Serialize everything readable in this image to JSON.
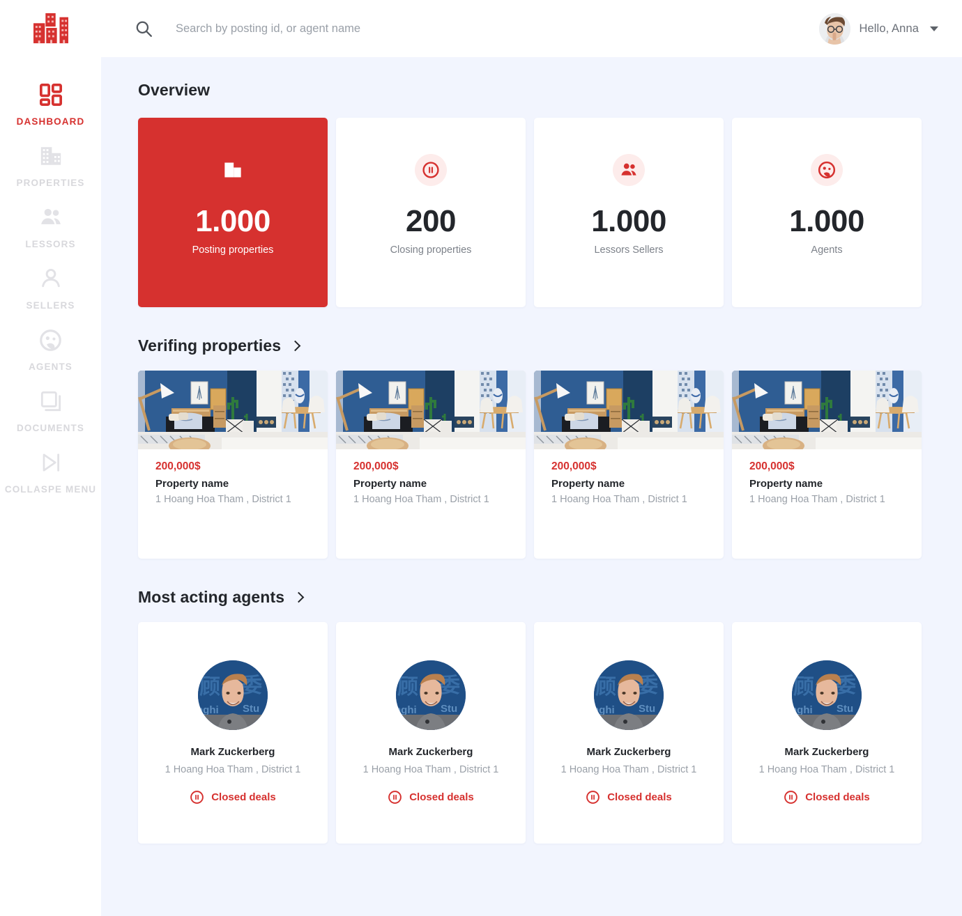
{
  "brand": {
    "logo_icon": "buildings-logo-icon",
    "accent_color": "#d6312f",
    "bg_color": "#f2f5fe"
  },
  "topbar": {
    "search": {
      "icon": "search-icon",
      "value": "",
      "placeholder": "Search by posting id, or agent name"
    },
    "user": {
      "greeting": "Hello, Anna",
      "avatar_icon": "user-avatar",
      "caret_icon": "chevron-down-icon"
    }
  },
  "sidebar": {
    "items": [
      {
        "label": "DASHBOARD",
        "icon": "dashboard-grid-icon",
        "active": true
      },
      {
        "label": "PROPERTIES",
        "icon": "building-icon",
        "active": false
      },
      {
        "label": "LESSORS",
        "icon": "people-group-icon",
        "active": false
      },
      {
        "label": "SELLERS",
        "icon": "person-icon",
        "active": false
      },
      {
        "label": "AGENTS",
        "icon": "support-agent-icon",
        "active": false
      },
      {
        "label": "DOCUMENTS",
        "icon": "documents-layers-icon",
        "active": false
      },
      {
        "label": "COLLASPE MENU",
        "icon": "collapse-skip-icon",
        "active": false
      }
    ]
  },
  "overview": {
    "title": "Overview",
    "cards": [
      {
        "value": "1.000",
        "label": "Posting properties",
        "icon": "building-icon",
        "accent": true
      },
      {
        "value": "200",
        "label": "Closing properties",
        "icon": "pause-circle-icon",
        "accent": false
      },
      {
        "value": "1.000",
        "label": "Lessors Sellers",
        "icon": "people-group-icon",
        "accent": false
      },
      {
        "value": "1.000",
        "label": "Agents",
        "icon": "support-agent-icon",
        "accent": false
      }
    ]
  },
  "verifying": {
    "title": "Verifing properties",
    "chevron_icon": "chevron-right-icon",
    "cards": [
      {
        "price": "200,000$",
        "name": "Property name",
        "address": "1 Hoang Hoa Tham , District 1",
        "image": "apartment-interior-photo"
      },
      {
        "price": "200,000$",
        "name": "Property name",
        "address": "1 Hoang Hoa Tham , District 1",
        "image": "apartment-interior-photo"
      },
      {
        "price": "200,000$",
        "name": "Property name",
        "address": "1 Hoang Hoa Tham , District 1",
        "image": "apartment-interior-photo"
      },
      {
        "price": "200,000$",
        "name": "Property name",
        "address": "1 Hoang Hoa Tham , District 1",
        "image": "apartment-interior-photo"
      }
    ]
  },
  "agents": {
    "title": "Most acting agents",
    "chevron_icon": "chevron-right-icon",
    "cards": [
      {
        "name": "Mark Zuckerberg",
        "address": "1 Hoang Hoa Tham , District 1",
        "deals_label": "Closed deals",
        "deals_icon": "pause-circle-icon",
        "avatar": "agent-portrait-photo"
      },
      {
        "name": "Mark Zuckerberg",
        "address": "1 Hoang Hoa Tham , District 1",
        "deals_label": "Closed deals",
        "deals_icon": "pause-circle-icon",
        "avatar": "agent-portrait-photo"
      },
      {
        "name": "Mark Zuckerberg",
        "address": "1 Hoang Hoa Tham , District 1",
        "deals_label": "Closed deals",
        "deals_icon": "pause-circle-icon",
        "avatar": "agent-portrait-photo"
      },
      {
        "name": "Mark Zuckerberg",
        "address": "1 Hoang Hoa Tham , District 1",
        "deals_label": "Closed deals",
        "deals_icon": "pause-circle-icon",
        "avatar": "agent-portrait-photo"
      }
    ]
  }
}
